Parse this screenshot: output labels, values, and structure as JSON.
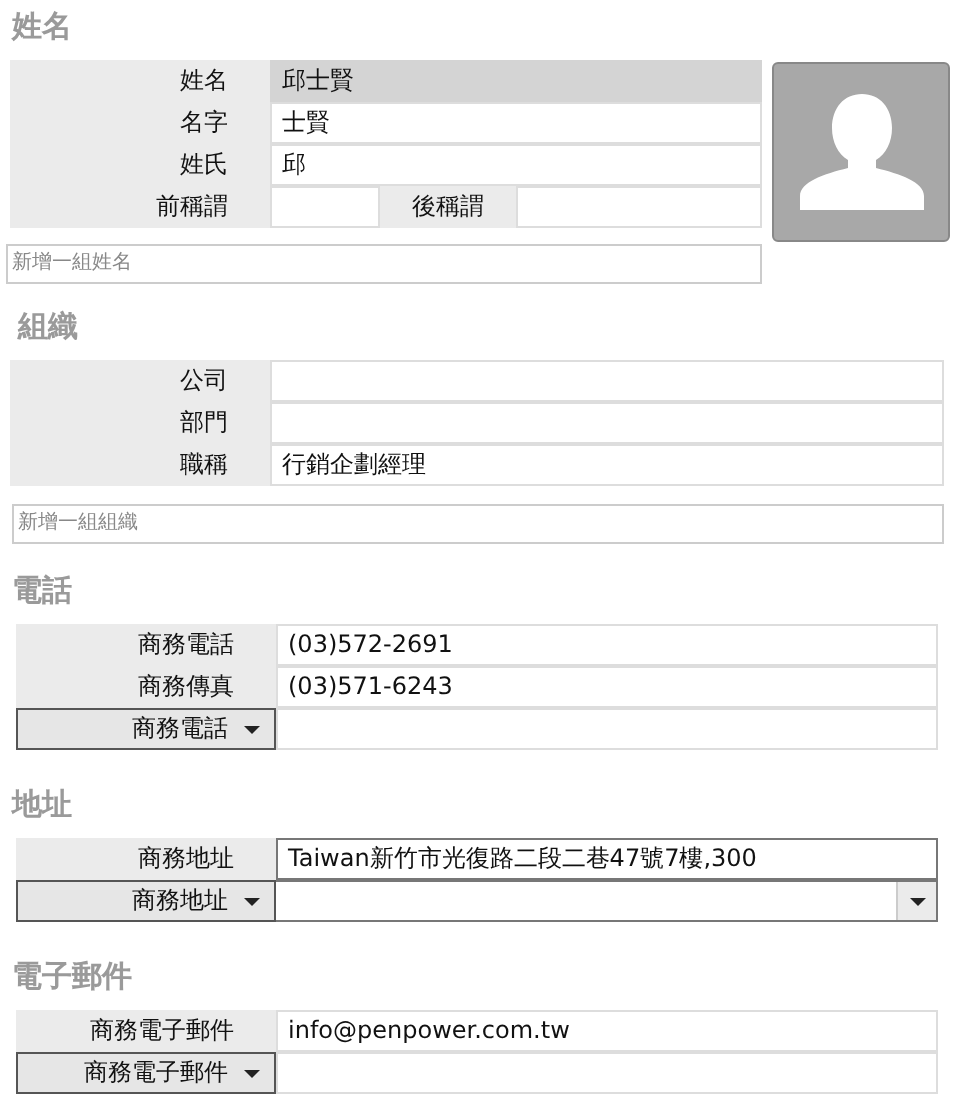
{
  "sections": [
    {
      "kind": "name",
      "title": "姓名",
      "rows": [
        {
          "kind": "computed",
          "label": "姓名",
          "value": "邱士賢"
        },
        {
          "kind": "text",
          "label": "名字",
          "value": "士賢"
        },
        {
          "kind": "text",
          "label": "姓氏",
          "value": "邱"
        },
        {
          "kind": "pair",
          "label": "前稱謂",
          "label_2": "後稱謂"
        }
      ],
      "add_field": {
        "placeholder": "新增一組姓名"
      }
    },
    {
      "kind": "organization",
      "title": "組織",
      "rows": [
        {
          "kind": "text",
          "label": "公司"
        },
        {
          "kind": "text",
          "label": "部門"
        },
        {
          "kind": "text",
          "label": "職稱",
          "value": "行銷企劃經理"
        }
      ],
      "add_field": {
        "placeholder": "新增一組組織"
      }
    },
    {
      "kind": "list",
      "title": "電話",
      "rows": [
        {
          "kind": "text",
          "label": "商務電話",
          "value": "(03)572-2691"
        },
        {
          "kind": "text",
          "label": "商務傳真",
          "value": "(03)571-6243"
        },
        {
          "kind": "select",
          "label": "商務電話"
        }
      ]
    },
    {
      "kind": "list",
      "title": "地址",
      "rows": [
        {
          "kind": "boxed",
          "label": "商務地址",
          "value": "Taiwan新竹市光復路二段二巷47號7樓,300"
        },
        {
          "kind": "select_combo",
          "label": "商務地址"
        }
      ]
    },
    {
      "kind": "list",
      "title": "電子郵件",
      "rows": [
        {
          "kind": "text",
          "label": "商務電子郵件",
          "value": "info@penpower.com.tw"
        },
        {
          "kind": "select",
          "label": "商務電子郵件"
        }
      ]
    }
  ]
}
